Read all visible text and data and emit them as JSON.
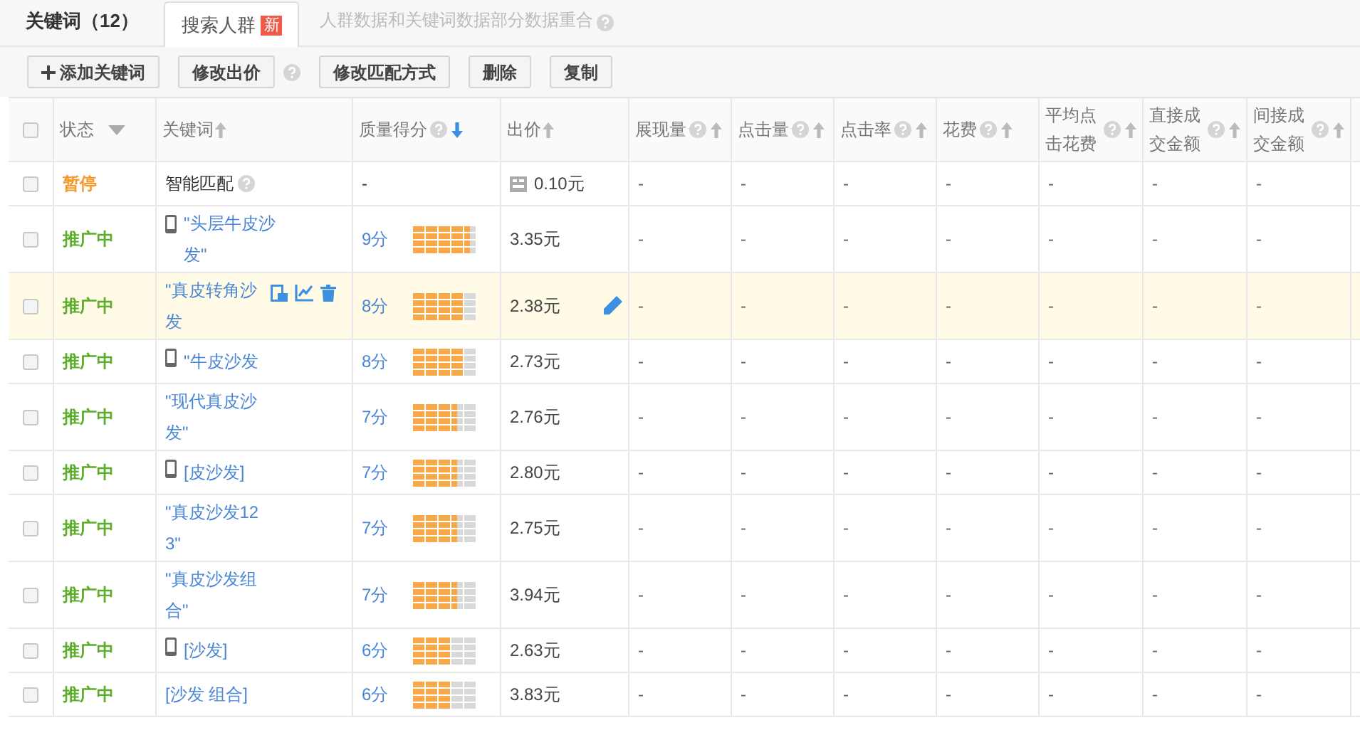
{
  "header": {
    "title": "关键词（12）",
    "tab": {
      "label": "搜索人群",
      "badge": "新"
    },
    "hint": "人群数据和关键词数据部分数据重合"
  },
  "toolbar": [
    {
      "label": "添加关键词",
      "kind": "add",
      "help": false
    },
    {
      "label": "修改出价",
      "kind": "plain",
      "help": true
    },
    {
      "label": "修改匹配方式",
      "kind": "plain",
      "help": false
    },
    {
      "label": "删除",
      "kind": "plain",
      "help": false
    },
    {
      "label": "复制",
      "kind": "plain",
      "help": false
    }
  ],
  "table": {
    "select_all": {
      "checked": false
    },
    "columns": [
      {
        "label": "状态",
        "help": false,
        "kind": "dropdown"
      },
      {
        "label": "关键词",
        "help": false,
        "kind": "sortable"
      },
      {
        "label": "质量得分",
        "help": true,
        "kind": "sorted"
      },
      {
        "label": "出价",
        "help": false,
        "kind": "sortable"
      },
      {
        "label": "展现量",
        "help": true,
        "kind": "sortable"
      },
      {
        "label": "点击量",
        "help": true,
        "kind": "sortable"
      },
      {
        "label": "点击率",
        "help": true,
        "kind": "sortable"
      },
      {
        "label": "花费",
        "help": true,
        "kind": "sortable"
      },
      {
        "label": "平均点击花费",
        "help": true,
        "kind": "sortable"
      },
      {
        "label": "直接成交金额",
        "help": true,
        "kind": "sortable"
      },
      {
        "label": "间接成交金额",
        "help": true,
        "kind": "sortable"
      }
    ],
    "rows": [
      {
        "checked": false,
        "status": "暂停",
        "kind": "paused",
        "keyword": "智能匹配",
        "mobile": false,
        "help": true,
        "score": "-",
        "bid": "0.10元",
        "bid_icon": true,
        "highlighted": false,
        "metrics": [
          "-",
          "-",
          "-",
          "-",
          "-",
          "-",
          "-"
        ]
      },
      {
        "checked": false,
        "status": "推广中",
        "kind": "active",
        "keyword": "\"头层牛皮沙发\"",
        "mobile": true,
        "help": false,
        "score": "9分",
        "level": 0.9,
        "bid": "3.35元",
        "bid_icon": false,
        "highlighted": false,
        "metrics": [
          "-",
          "-",
          "-",
          "-",
          "-",
          "-",
          "-"
        ]
      },
      {
        "checked": false,
        "status": "推广中",
        "kind": "active",
        "keyword": "\"真皮转角沙发",
        "mobile": false,
        "help": false,
        "score": "8分",
        "level": 0.8,
        "bid": "2.38元",
        "bid_icon": false,
        "highlighted": true,
        "metrics": [
          "-",
          "-",
          "-",
          "-",
          "-",
          "-",
          "-"
        ]
      },
      {
        "checked": false,
        "status": "推广中",
        "kind": "active",
        "keyword": "\"牛皮沙发",
        "mobile": true,
        "help": false,
        "score": "8分",
        "level": 0.8,
        "bid": "2.73元",
        "bid_icon": false,
        "highlighted": false,
        "metrics": [
          "-",
          "-",
          "-",
          "-",
          "-",
          "-",
          "-"
        ]
      },
      {
        "checked": false,
        "status": "推广中",
        "kind": "active",
        "keyword": "\"现代真皮沙发\"",
        "mobile": false,
        "help": false,
        "score": "7分",
        "level": 0.7,
        "bid": "2.76元",
        "bid_icon": false,
        "highlighted": false,
        "metrics": [
          "-",
          "-",
          "-",
          "-",
          "-",
          "-",
          "-"
        ]
      },
      {
        "checked": false,
        "status": "推广中",
        "kind": "active",
        "keyword": "[皮沙发]",
        "mobile": true,
        "help": false,
        "score": "7分",
        "level": 0.7,
        "bid": "2.80元",
        "bid_icon": false,
        "highlighted": false,
        "metrics": [
          "-",
          "-",
          "-",
          "-",
          "-",
          "-",
          "-"
        ]
      },
      {
        "checked": false,
        "status": "推广中",
        "kind": "active",
        "keyword": "\"真皮沙发123\"",
        "mobile": false,
        "help": false,
        "score": "7分",
        "level": 0.7,
        "bid": "2.75元",
        "bid_icon": false,
        "highlighted": false,
        "metrics": [
          "-",
          "-",
          "-",
          "-",
          "-",
          "-",
          "-"
        ]
      },
      {
        "checked": false,
        "status": "推广中",
        "kind": "active",
        "keyword": "\"真皮沙发组合\"",
        "mobile": false,
        "help": false,
        "score": "7分",
        "level": 0.7,
        "bid": "3.94元",
        "bid_icon": false,
        "highlighted": false,
        "metrics": [
          "-",
          "-",
          "-",
          "-",
          "-",
          "-",
          "-"
        ]
      },
      {
        "checked": false,
        "status": "推广中",
        "kind": "active",
        "keyword": "[沙发]",
        "mobile": true,
        "help": false,
        "score": "6分",
        "level": 0.6,
        "bid": "2.63元",
        "bid_icon": false,
        "highlighted": false,
        "metrics": [
          "-",
          "-",
          "-",
          "-",
          "-",
          "-",
          "-"
        ]
      },
      {
        "checked": false,
        "status": "推广中",
        "kind": "active",
        "keyword": "[沙发 组合]",
        "mobile": false,
        "help": false,
        "score": "6分",
        "level": 0.6,
        "bid": "3.83元",
        "bid_icon": false,
        "highlighted": false,
        "metrics": [
          "-",
          "-",
          "-",
          "-",
          "-",
          "-",
          "-"
        ]
      }
    ]
  }
}
